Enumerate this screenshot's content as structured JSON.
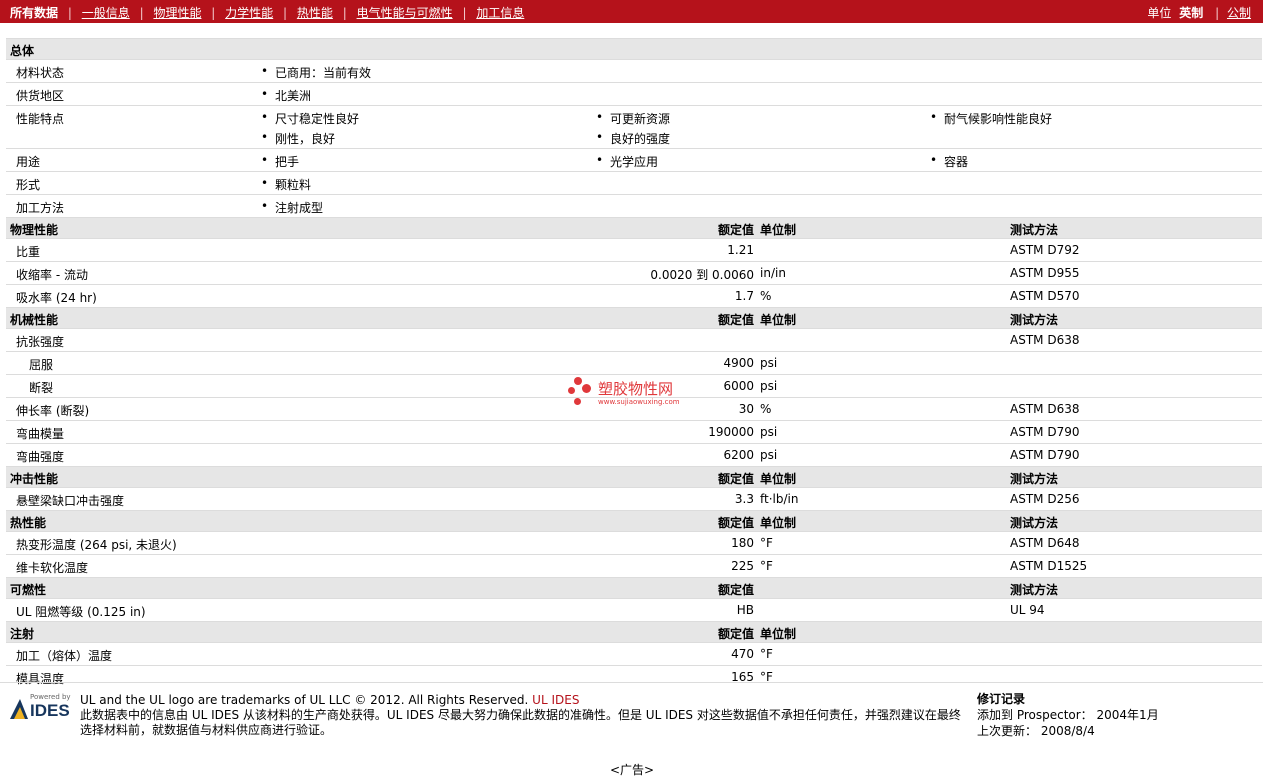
{
  "topnav": {
    "all": "所有数据",
    "links": [
      "一般信息",
      "物理性能",
      "力学性能",
      "热性能",
      "电气性能与可燃性",
      "加工信息"
    ]
  },
  "units": {
    "label": "单位",
    "current": "英制",
    "other": "公制"
  },
  "general": {
    "title": "总体",
    "rows": [
      {
        "label": "材料状态",
        "items": [
          "已商用：当前有效"
        ]
      },
      {
        "label": "供货地区",
        "items": [
          "北美洲"
        ]
      },
      {
        "label": "性能特点",
        "items": [
          "尺寸稳定性良好",
          "可更新资源",
          "耐气候影响性能良好",
          "刚性，良好",
          "良好的强度"
        ]
      },
      {
        "label": "用途",
        "items": [
          "把手",
          "光学应用",
          "容器"
        ]
      },
      {
        "label": "形式",
        "items": [
          "颗粒料"
        ]
      },
      {
        "label": "加工方法",
        "items": [
          "注射成型"
        ]
      }
    ]
  },
  "headers": {
    "value": "额定值",
    "unit": "单位制",
    "test": "测试方法"
  },
  "sections": [
    {
      "title": "物理性能",
      "showUnit": true,
      "rows": [
        {
          "label": "比重",
          "value": "1.21",
          "unit": "",
          "test": "ASTM D792"
        },
        {
          "label": "收缩率  - 流动",
          "value": "0.0020 到  0.0060",
          "unit": "in/in",
          "test": "ASTM D955"
        },
        {
          "label": "吸水率  (24 hr)",
          "value": "1.7",
          "unit": "%",
          "test": "ASTM D570"
        }
      ]
    },
    {
      "title": "机械性能",
      "showUnit": true,
      "rows": [
        {
          "label": "抗张强度",
          "value": "",
          "unit": "",
          "test": "ASTM D638"
        },
        {
          "label": "屈服",
          "value": "4900",
          "unit": "psi",
          "test": "",
          "indent": true
        },
        {
          "label": "断裂",
          "value": "6000",
          "unit": "psi",
          "test": "",
          "indent": true
        },
        {
          "label": "伸长率  (断裂)",
          "value": "30",
          "unit": "%",
          "test": "ASTM D638"
        },
        {
          "label": "弯曲模量",
          "value": "190000",
          "unit": "psi",
          "test": "ASTM D790"
        },
        {
          "label": "弯曲强度",
          "value": "6200",
          "unit": "psi",
          "test": "ASTM D790"
        }
      ]
    },
    {
      "title": "冲击性能",
      "showUnit": true,
      "rows": [
        {
          "label": "悬壁梁缺口冲击强度",
          "value": "3.3",
          "unit": "ft·lb/in",
          "test": "ASTM D256"
        }
      ]
    },
    {
      "title": "热性能",
      "showUnit": true,
      "rows": [
        {
          "label": "热变形温度  (264 psi, 未退火)",
          "value": "180",
          "unit": "°F",
          "test": "ASTM D648"
        },
        {
          "label": "维卡软化温度",
          "value": "225",
          "unit": "°F",
          "test": "ASTM D1525"
        }
      ]
    },
    {
      "title": "可燃性",
      "showUnit": false,
      "rows": [
        {
          "label": "UL 阻燃等级  (0.125 in)",
          "value": "HB",
          "unit": "",
          "test": "UL 94"
        }
      ]
    },
    {
      "title": "注射",
      "showUnit": true,
      "showTest": false,
      "rows": [
        {
          "label": "加工（熔体）温度",
          "value": "470",
          "unit": "°F",
          "test": ""
        },
        {
          "label": "模具温度",
          "value": "165",
          "unit": "°F",
          "test": ""
        }
      ]
    }
  ],
  "watermark": {
    "text": "塑胶物性网",
    "url": "www.sujiaowuxing.com"
  },
  "footer": {
    "logo_top": "Powered by",
    "logo_text": "IDES",
    "line1": "UL and the UL logo are trademarks of UL LLC © 2012. All Rights Reserved. ",
    "line1_link": "UL IDES",
    "line2": "此数据表中的信息由  UL IDES 从该材料的生产商处获得。UL IDES 尽最大努力确保此数据的准确性。但是  UL IDES 对这些数据值不承担任何责任，并强烈建议在最终选择材料前，就数据值与材料供应商进行验证。",
    "revision": {
      "title": "修订记录",
      "added_label": "添加到  Prospector：",
      "added_value": "2004年1月",
      "updated_label": "上次更新：",
      "updated_value": "2008/8/4"
    }
  },
  "ad": "<广告>"
}
